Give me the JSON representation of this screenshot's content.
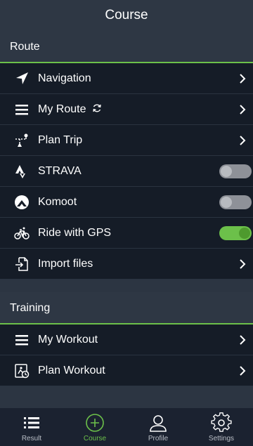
{
  "header": {
    "title": "Course"
  },
  "sections": {
    "route": {
      "title": "Route",
      "items": [
        {
          "label": "Navigation",
          "icon": "navigation-arrow-icon",
          "control": "chevron"
        },
        {
          "label": "My Route",
          "icon": "list-icon",
          "control": "chevron",
          "trailing_icon": "sync-icon"
        },
        {
          "label": "Plan Trip",
          "icon": "plan-trip-icon",
          "control": "chevron"
        },
        {
          "label": "STRAVA",
          "icon": "strava-icon",
          "control": "toggle",
          "on": false
        },
        {
          "label": "Komoot",
          "icon": "komoot-icon",
          "control": "toggle",
          "on": false
        },
        {
          "label": "Ride with GPS",
          "icon": "bicycle-icon",
          "control": "toggle",
          "on": true
        },
        {
          "label": "Import files",
          "icon": "import-file-icon",
          "control": "chevron"
        }
      ]
    },
    "training": {
      "title": "Training",
      "items": [
        {
          "label": "My Workout",
          "icon": "list-icon",
          "control": "chevron"
        },
        {
          "label": "Plan Workout",
          "icon": "plan-workout-icon",
          "control": "chevron"
        }
      ]
    }
  },
  "tabbar": {
    "tabs": [
      {
        "label": "Result",
        "icon": "result-list-icon",
        "active": false
      },
      {
        "label": "Course",
        "icon": "add-circle-icon",
        "active": true
      },
      {
        "label": "Profile",
        "icon": "profile-icon",
        "active": false
      },
      {
        "label": "Settings",
        "icon": "gear-icon",
        "active": false
      }
    ]
  },
  "colors": {
    "accent": "#6cc04a",
    "row_background": "#151c27",
    "header_background": "#2e3744",
    "tabbar_background": "#1b2230"
  }
}
